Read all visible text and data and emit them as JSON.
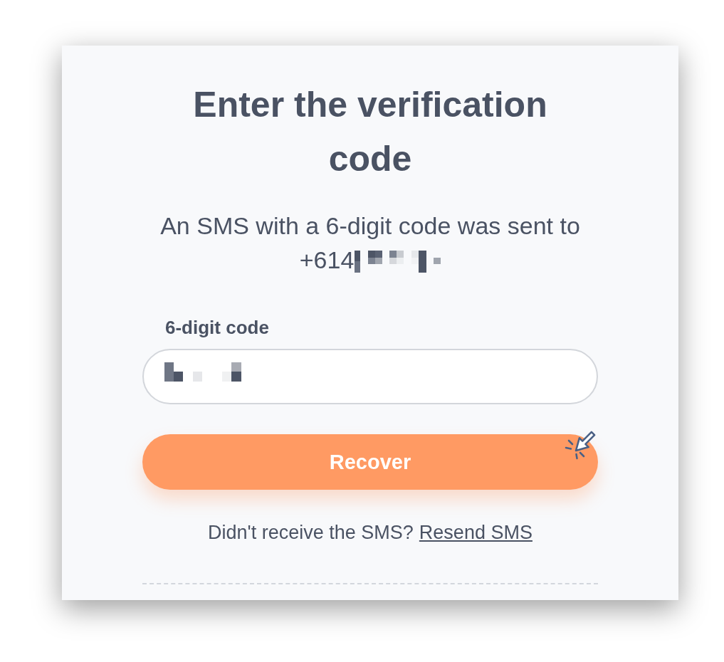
{
  "title": "Enter the verification code",
  "message": {
    "text": "An SMS with a 6-digit code was sent to",
    "phone": "+614",
    "phone_redacted": true
  },
  "code_field": {
    "label": "6-digit code",
    "value_redacted": true
  },
  "submit_button": {
    "label": "Recover",
    "cursor": true
  },
  "resend": {
    "prompt": "Didn't receive the SMS?",
    "link": "Resend SMS"
  }
}
